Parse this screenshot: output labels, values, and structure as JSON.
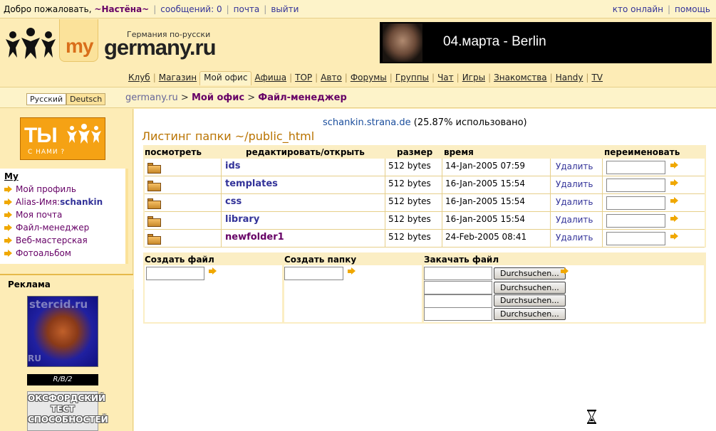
{
  "topbar": {
    "welcome": "Добро пожаловать,",
    "username": "~Настёна~",
    "messages": "сообщений: 0",
    "mail": "почта",
    "logout": "выйти",
    "online": "кто онлайн",
    "help": "помощь"
  },
  "header": {
    "logo_my": "my",
    "logo_name": "germany.ru",
    "tagline": "Германия по-русски",
    "banner_text": "04.марта  -  Berlin"
  },
  "nav": {
    "items": [
      "Клуб",
      "Магазин",
      "Мой офис",
      "Афиша",
      "TOP",
      "Авто",
      "Форумы",
      "Группы",
      "Чат",
      "Игры",
      "Знакомства",
      "Handy",
      "TV"
    ],
    "active": "Мой офис"
  },
  "lang": {
    "ru": "Русский",
    "de": "Deutsch"
  },
  "breadcrumb": {
    "c1": "germany.ru",
    "sep": " > ",
    "c2": "Мой офис",
    "c3": "Файл-менеджер"
  },
  "sidebar": {
    "logo_big": "ТЫ",
    "logo_small": "С НАМИ ?",
    "menu_title": "My",
    "items": {
      "profile": "Мой профиль",
      "alias_label": "Alias-Имя: ",
      "alias_value": "schankin",
      "mail": "Моя почта",
      "files": "Файл-менеджер",
      "web": "Веб-мастерская",
      "photo": "Фотоальбом"
    },
    "ads_title": "Реклама",
    "ad_watermark": "stercid.ru",
    "ad_watermark2": "RU",
    "ad_rb": "R/B/2",
    "oxford": "ОКСФОРДСКИЙ ТЕСТ СПОСОБНОСТЕЙ"
  },
  "main": {
    "host": "schankin.strana.de",
    "usage": " (25.87% использовано)",
    "listing": "Листинг папки ~/public_html",
    "headers": {
      "view": "посмотреть",
      "edit": "редактировать/открыть",
      "size": "размер",
      "time": "время",
      "rename": "переименовать"
    },
    "files": [
      {
        "name": "ids",
        "size": "512 bytes",
        "time": "14-Jan-2005 07:59",
        "del": "Удалить"
      },
      {
        "name": "templates",
        "size": "512 bytes",
        "time": "16-Jan-2005 15:54",
        "del": "Удалить"
      },
      {
        "name": "css",
        "size": "512 bytes",
        "time": "16-Jan-2005 15:54",
        "del": "Удалить"
      },
      {
        "name": "library",
        "size": "512 bytes",
        "time": "16-Jan-2005 15:54",
        "del": "Удалить"
      },
      {
        "name": "newfolder1",
        "size": "512 bytes",
        "time": "24-Feb-2005 08:41",
        "del": "Удалить"
      }
    ],
    "create_file": "Создать файл",
    "create_folder": "Создать папку",
    "upload": "Закачать файл",
    "browse": "Durchsuchen..."
  }
}
